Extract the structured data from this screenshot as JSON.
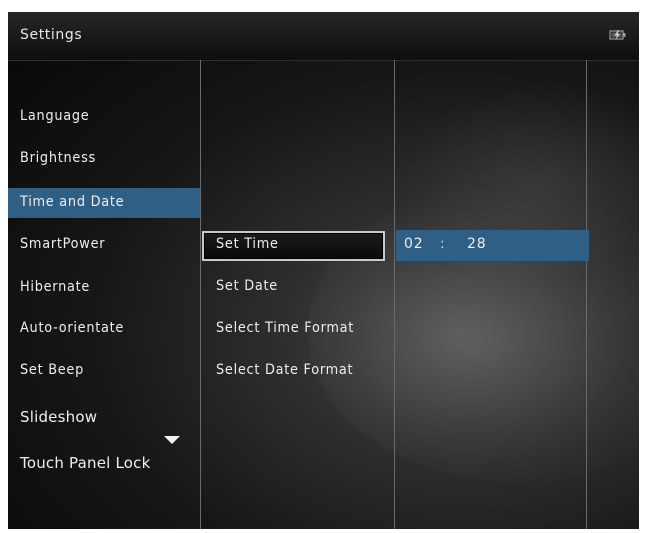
{
  "header": {
    "title": "Settings",
    "battery_icon": "battery-charging-icon"
  },
  "menu": {
    "items": [
      {
        "label": "Language"
      },
      {
        "label": "Brightness"
      },
      {
        "label": "Time and Date",
        "selected": true
      },
      {
        "label": "SmartPower"
      },
      {
        "label": "Hibernate"
      },
      {
        "label": "Auto-orientate"
      },
      {
        "label": "Set Beep"
      },
      {
        "label": "Slideshow"
      },
      {
        "label": "Touch Panel Lock"
      }
    ],
    "scroll_icon": "chevron-down-icon"
  },
  "submenu": {
    "items": [
      {
        "label": "Set Time",
        "focused": true
      },
      {
        "label": "Set Date"
      },
      {
        "label": "Select Time Format"
      },
      {
        "label": "Select Date Format"
      }
    ]
  },
  "time": {
    "hours": "02",
    "separator": ":",
    "minutes": "28"
  },
  "colors": {
    "selection": "#2f5f84",
    "text": "#eeeeee",
    "background": "#0b0b0b"
  }
}
